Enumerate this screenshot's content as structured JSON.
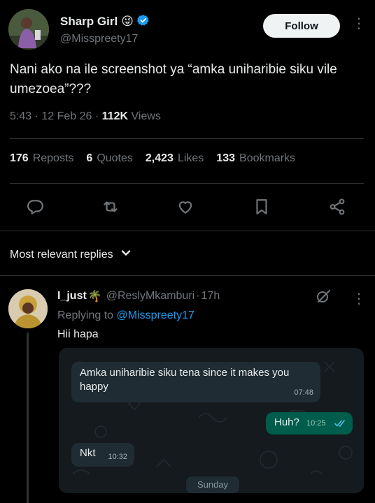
{
  "author": {
    "display_name": "Sharp Girl",
    "name_emoji": "😜",
    "handle": "@Misspreety17",
    "follow_label": "Follow"
  },
  "tweet": {
    "text": "Nani ako na ile screenshot ya “amka uniharibie siku vile umezoea”???",
    "time": "5:43",
    "date": "12 Feb 26",
    "views_count": "112K",
    "views_label": "Views"
  },
  "stats": {
    "reposts": {
      "count": "176",
      "label": "Reposts"
    },
    "quotes": {
      "count": "6",
      "label": "Quotes"
    },
    "likes": {
      "count": "2,423",
      "label": "Likes"
    },
    "bookmarks": {
      "count": "133",
      "label": "Bookmarks"
    }
  },
  "actions": [
    "reply-icon",
    "repost-icon",
    "like-icon",
    "bookmark-icon",
    "share-icon"
  ],
  "sort": {
    "label": "Most relevant replies"
  },
  "reply": {
    "name": "I_just",
    "name_emoji": "🌴",
    "handle": "@ReslyMkamburi",
    "age": "17h",
    "replying_prefix": "Replying to",
    "replying_to": "@Misspreety17",
    "text": "Hii hapa"
  },
  "chat": {
    "messages": [
      {
        "direction": "in",
        "text": "Amka uniharibie siku tena since it makes you happy",
        "time": "07:48"
      },
      {
        "direction": "out",
        "text": "Huh?",
        "time": "10:25"
      },
      {
        "direction": "in",
        "text": "Nkt",
        "time": "10:32"
      }
    ],
    "day_label": "Sunday"
  },
  "colors": {
    "background": "#000000",
    "text_primary": "#e7e9ea",
    "text_secondary": "#71767b",
    "divider": "#2f3336",
    "accent_blue": "#1d9bf0",
    "chat_bubble_in": "#1f2c33",
    "chat_bubble_out": "#005c4b"
  }
}
